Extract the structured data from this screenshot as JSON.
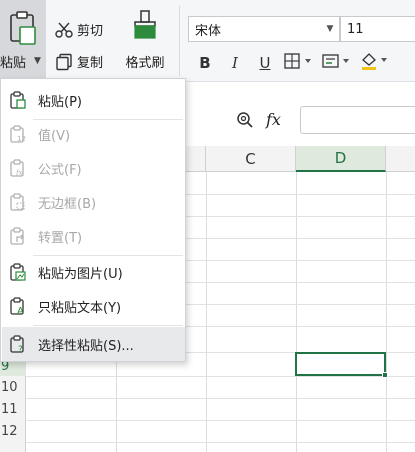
{
  "ribbon": {
    "paste_label": "粘贴",
    "cut_label": "剪切",
    "copy_label": "复制",
    "format_painter_label": "格式刷",
    "font_name": "宋体",
    "font_size": "11",
    "bold_label": "B",
    "italic_label": "I",
    "underline_label": "U"
  },
  "formula_bar": {
    "fx_label": "fx",
    "value": ""
  },
  "sheet": {
    "columns": [
      "C",
      "D"
    ],
    "active_column": "D",
    "rows": [
      "9",
      "10",
      "11",
      "12"
    ],
    "active_row": "9"
  },
  "paste_menu": {
    "items": [
      {
        "label": "粘贴(P)",
        "icon": "paste-icon",
        "enabled": true
      },
      {
        "label": "值(V)",
        "icon": "paste-values-icon",
        "enabled": false
      },
      {
        "label": "公式(F)",
        "icon": "paste-formula-icon",
        "enabled": false
      },
      {
        "label": "无边框(B)",
        "icon": "paste-no-border-icon",
        "enabled": false
      },
      {
        "label": "转置(T)",
        "icon": "paste-transpose-icon",
        "enabled": false
      },
      {
        "label": "粘贴为图片(U)",
        "icon": "paste-as-picture-icon",
        "enabled": true
      },
      {
        "label": "只粘贴文本(Y)",
        "icon": "paste-text-only-icon",
        "enabled": true
      },
      {
        "label": "选择性粘贴(S)...",
        "icon": "paste-special-icon",
        "enabled": true
      }
    ]
  },
  "colors": {
    "accent_green": "#217346",
    "menu_hover": "#e8e9eb",
    "disabled_text": "#a8a8a8"
  }
}
